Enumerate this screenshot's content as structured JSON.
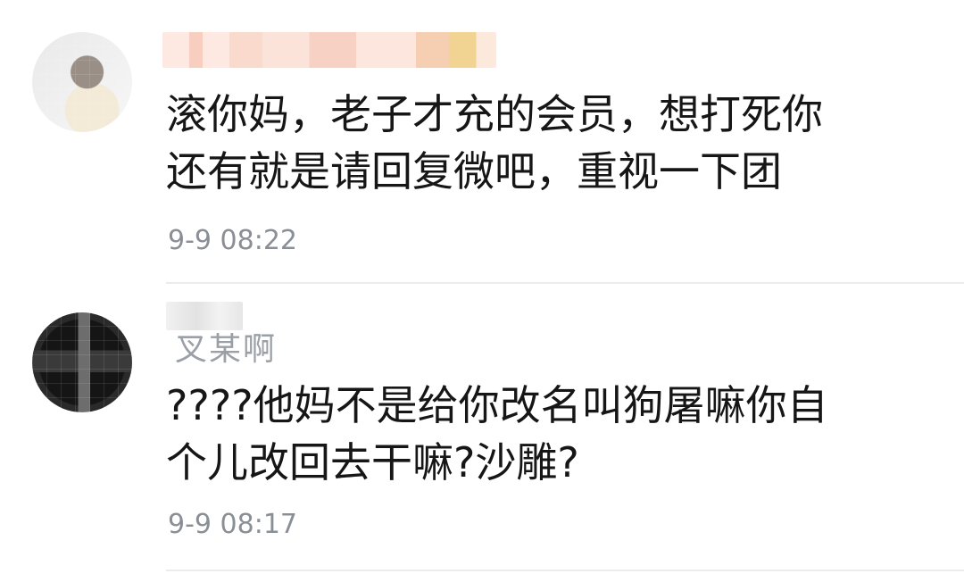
{
  "comments": [
    {
      "username_visible": "",
      "text": "滚你妈，老子才充的会员，想打死你\n还有就是请回复微吧，重视一下团",
      "time": "9-9 08:22"
    },
    {
      "username_visible": "叉某啊",
      "text": "????他妈不是给你改名叫狗屠嘛你自\n个儿改回去干嘛?沙雕?",
      "time": "9-9 08:17"
    }
  ]
}
